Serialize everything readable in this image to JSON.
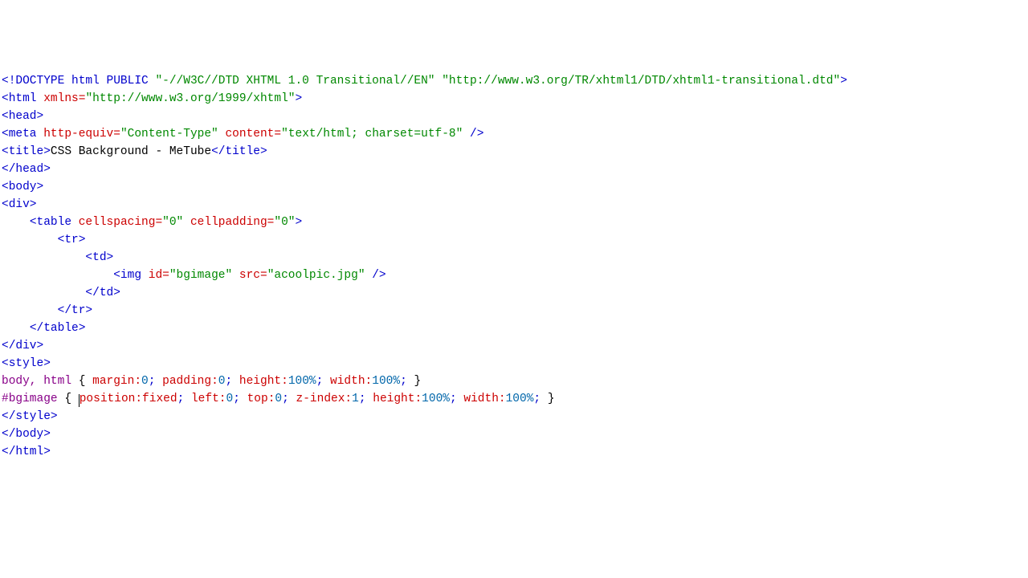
{
  "code": {
    "l1": {
      "doctype": "<!DOCTYPE html PUBLIC ",
      "pub": "\"-//W3C//DTD XHTML 1.0 Transitional//EN\"",
      "sp": " ",
      "url": "\"http://www.w3.org/TR/xhtml1/DTD/xhtml1-transitional.dtd\"",
      "close": ">"
    },
    "l2": {
      "open": "<html ",
      "attr": "xmlns=",
      "val": "\"http://www.w3.org/1999/xhtml\"",
      "close": ">"
    },
    "l3": "<head>",
    "l4": {
      "open": "<meta ",
      "a1": "http-equiv=",
      "v1": "\"Content-Type\"",
      "sp": " ",
      "a2": "content=",
      "v2": "\"text/html; charset=utf-8\"",
      "close": " />"
    },
    "l5": {
      "open": "<title>",
      "text": "CSS Background - MeTube",
      "close": "</title>"
    },
    "l6": "</head>",
    "l7": "<body>",
    "l8": "<div>",
    "l9": {
      "indent": "    ",
      "open": "<table ",
      "a1": "cellspacing=",
      "v1": "\"0\"",
      "sp": " ",
      "a2": "cellpadding=",
      "v2": "\"0\"",
      "close": ">"
    },
    "l10": {
      "indent": "        ",
      "tag": "<tr>"
    },
    "l11": {
      "indent": "            ",
      "tag": "<td>"
    },
    "l12": {
      "indent": "                ",
      "open": "<img ",
      "a1": "id=",
      "v1": "\"bgimage\"",
      "sp": " ",
      "a2": "src=",
      "v2": "\"acoolpic.jpg\"",
      "close": " />"
    },
    "l13": {
      "indent": "            ",
      "tag": "</td>"
    },
    "l14": {
      "indent": "        ",
      "tag": "</tr>"
    },
    "l15": {
      "indent": "    ",
      "tag": "</table>"
    },
    "l16": "</div>",
    "l17": "<style>",
    "l18": {
      "sel": "body, html",
      "sp": " ",
      "ob": "{ ",
      "p1": "margin:",
      "n1": "0",
      "s1": ";",
      "sp2": " ",
      "p2": "padding:",
      "n2": "0",
      "s2": ";",
      "sp3": " ",
      "p3": "height:",
      "n3": "100%",
      "s3": ";",
      "sp4": " ",
      "p4": "width:",
      "n4": "100%",
      "s4": ";",
      "cb": " }"
    },
    "l19": {
      "sel": "#bgimage",
      "sp": " ",
      "ob": "{ ",
      "p1": "position:fixed",
      "s1": ";",
      "sp2": " ",
      "p2": "left:",
      "n2": "0",
      "s2": ";",
      "sp3": " ",
      "p3": "top:",
      "n3": "0",
      "s3": ";",
      "sp4": " ",
      "p4": "z-index:",
      "n4": "1",
      "s4": ";",
      "sp5": " ",
      "p5": "height:",
      "n5": "100%",
      "s5": ";",
      "sp6": " ",
      "p6": "width:",
      "n6": "100%",
      "s6": ";",
      "cb": " }"
    },
    "l20": "</style>",
    "l21": "</body>",
    "l22": "</html>"
  }
}
